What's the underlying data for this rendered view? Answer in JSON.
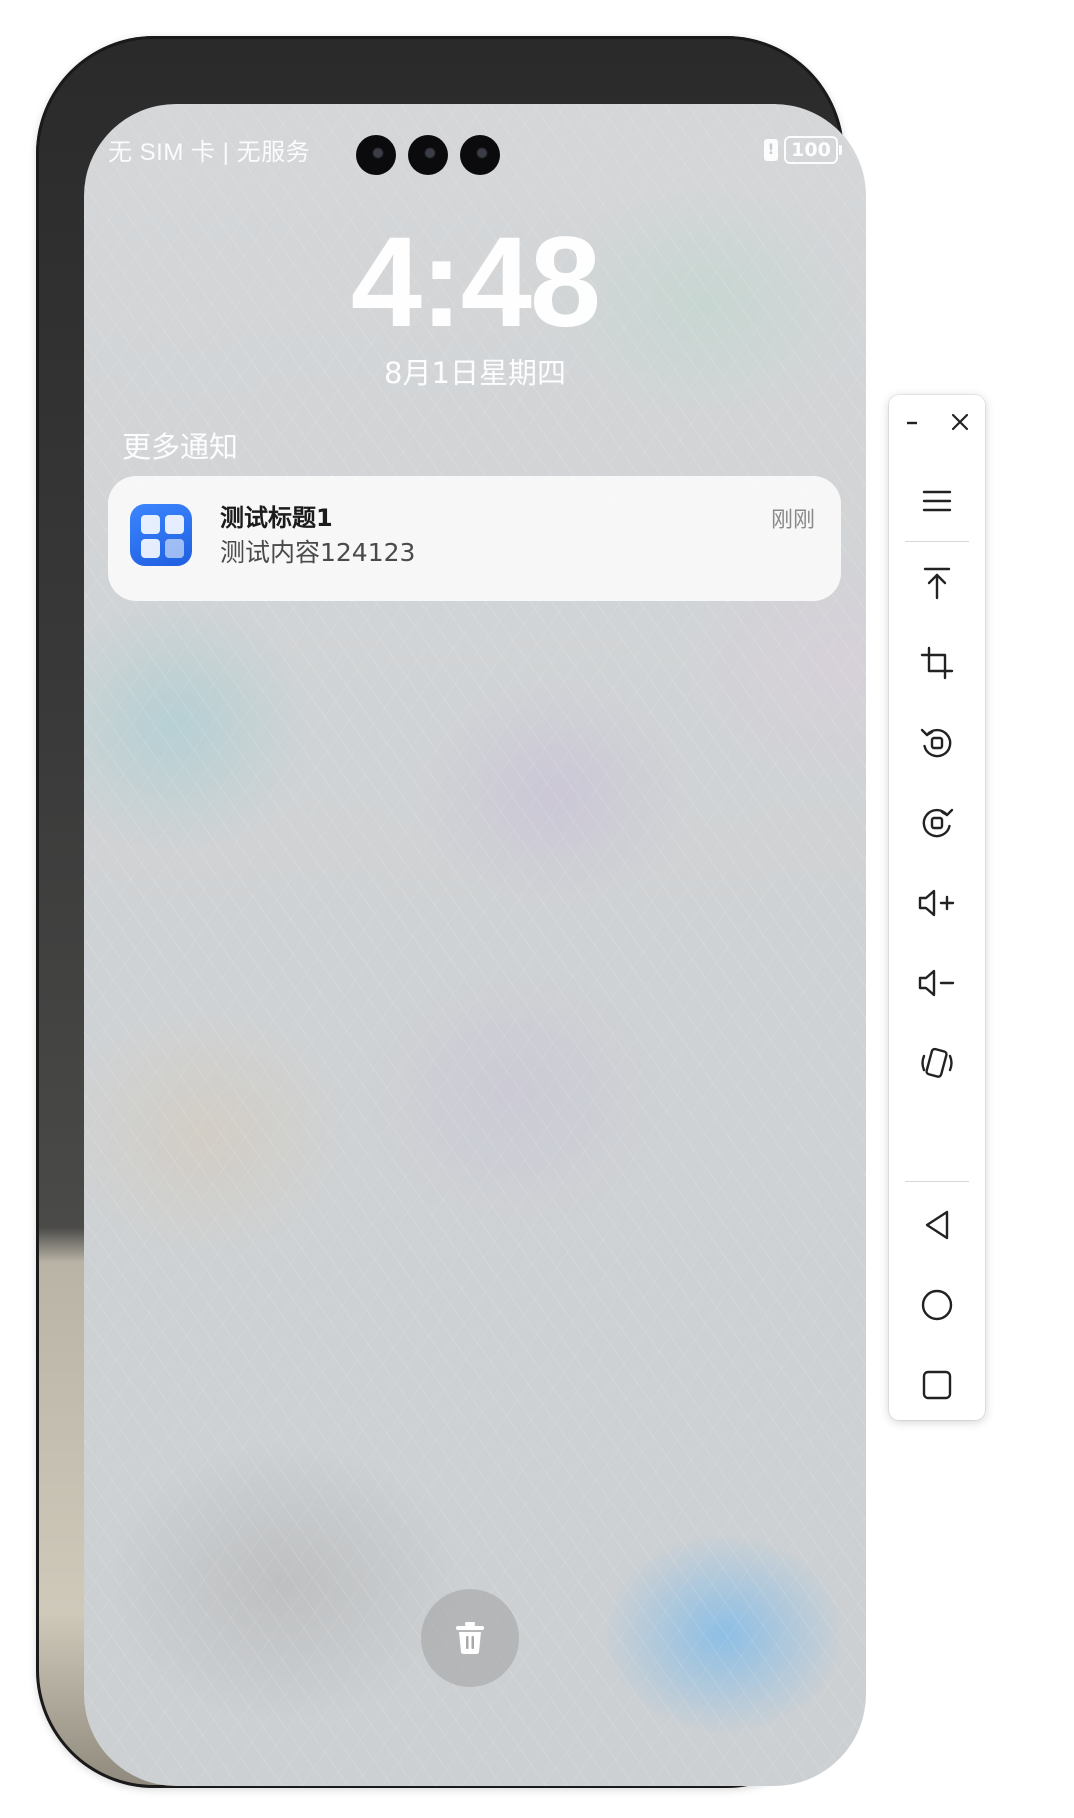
{
  "status_bar": {
    "carrier_text": "无 SIM 卡 | 无服务",
    "battery": "100"
  },
  "lockscreen": {
    "time": "4:48",
    "date": "8月1日星期四",
    "notifications_header": "更多通知"
  },
  "notification": {
    "title": "测试标题1",
    "body": "测试内容124123",
    "time": "刚刚",
    "app_icon": "app-grid-icon"
  },
  "toolbar": {
    "buttons": [
      "minimize-icon",
      "close-icon",
      "menu-icon",
      "pin-top-icon",
      "crop-icon",
      "rotate-left-icon",
      "rotate-right-icon",
      "volume-up-icon",
      "volume-down-icon",
      "shake-icon",
      "back-icon",
      "home-icon",
      "recents-icon"
    ]
  },
  "colors": {
    "app_icon_blue": "#2a6ff0",
    "toolbar_bg": "#ffffff"
  }
}
